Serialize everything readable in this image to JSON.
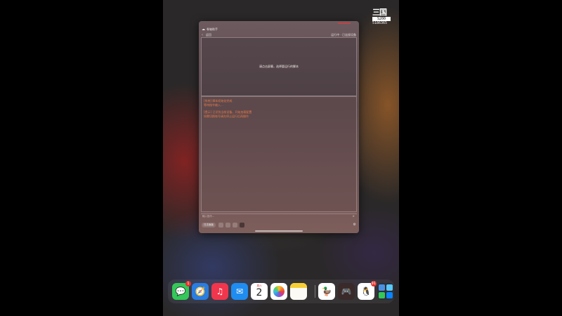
{
  "watermark": {
    "logo": "三国",
    "badge": "S200",
    "id": "5186365"
  },
  "window": {
    "title": "卷轴助手",
    "back_label": "返回",
    "status": "运行中 · 已连接设备",
    "hint": "请点击屏幕，选择要运行的脚本",
    "log_lines": [
      "[系统] 脚本初始化完成",
      "等待指令输入...",
      "[提示] 已识别当前设备，开始加载配置",
      "如需切换账号请先停止运行后再操作"
    ],
    "input_placeholder": "输入指令...",
    "toolbar": {
      "pill_label": "日志面板"
    }
  },
  "dock": {
    "apps": [
      {
        "name": "Messages",
        "glyph": "💬",
        "bg": "#34c759",
        "badge": "1"
      },
      {
        "name": "Safari",
        "glyph": "🧭",
        "bg": "#2a7de1",
        "badge": ""
      },
      {
        "name": "Music",
        "glyph": "♫",
        "bg": "#f0364c",
        "badge": ""
      },
      {
        "name": "Mail",
        "glyph": "✉",
        "bg": "#1f8cf0",
        "badge": ""
      },
      {
        "name": "Calendar",
        "day": "周六",
        "date": "2",
        "bg": "#ffffff",
        "badge": ""
      },
      {
        "name": "Photos",
        "bg": "#ffffff",
        "badge": ""
      },
      {
        "name": "Notes",
        "bg": "#fbfaf4",
        "badge": ""
      },
      {
        "name": "Duck App",
        "glyph": "🦆",
        "bg": "#ffffff",
        "badge": ""
      },
      {
        "name": "Call of Duty",
        "glyph": "🎮",
        "bg": "#3a2a2a",
        "badge": ""
      },
      {
        "name": "QQ",
        "glyph": "🐧",
        "bg": "#ffffff",
        "badge": "91"
      },
      {
        "name": "App Library",
        "bg": "#2b2f3a",
        "badge": ""
      }
    ]
  }
}
